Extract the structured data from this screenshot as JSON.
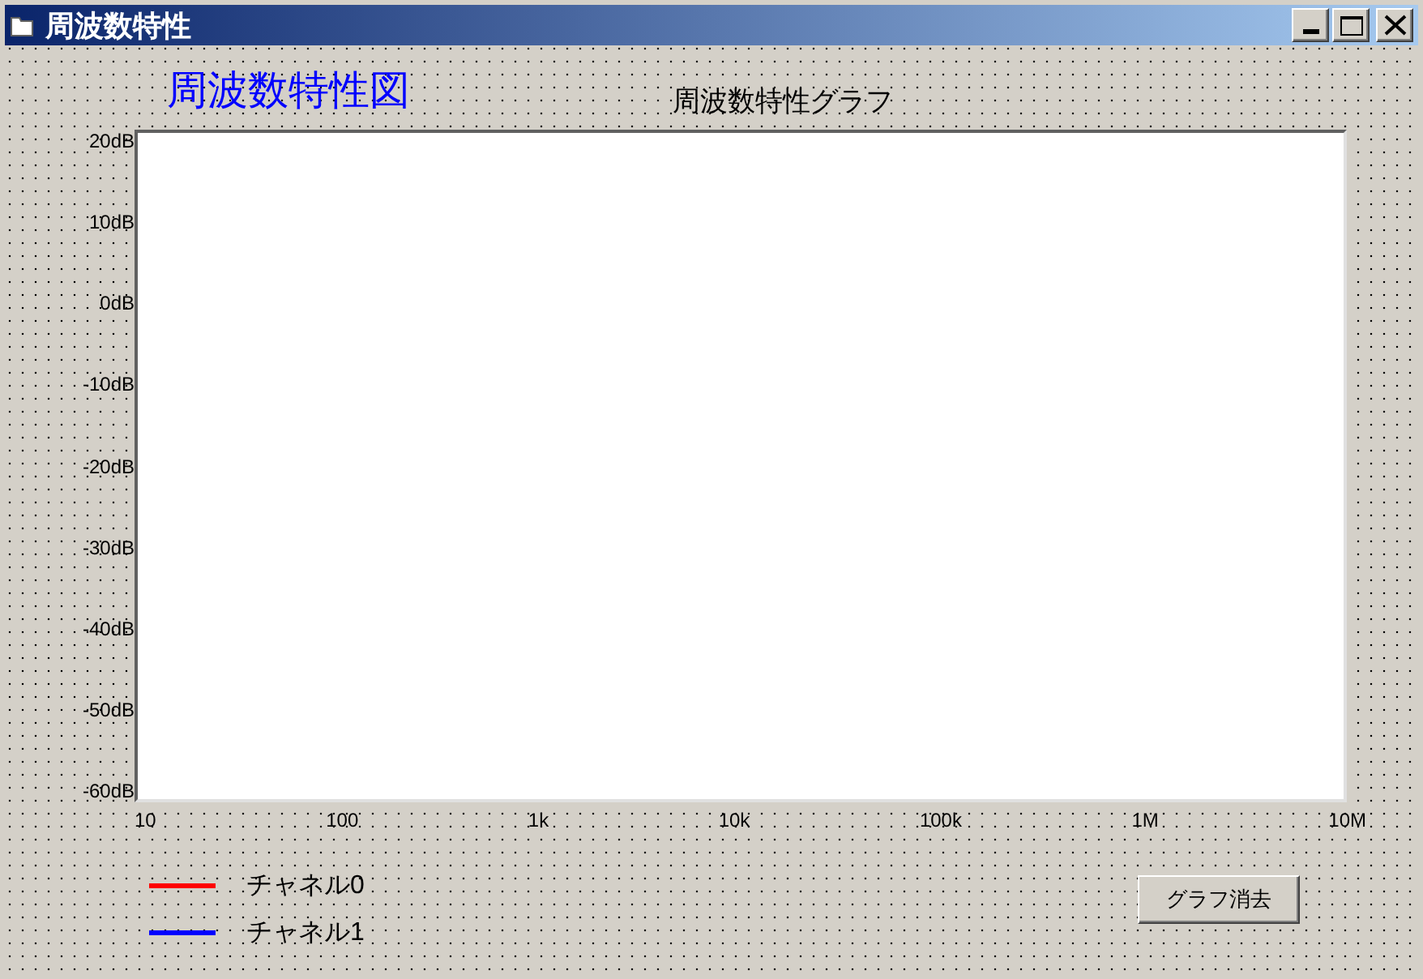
{
  "window": {
    "title": "周波数特性"
  },
  "heading": "周波数特性図",
  "graph": {
    "title": "周波数特性グラフ",
    "y_labels": [
      "20dB",
      "10dB",
      "0dB",
      "-10dB",
      "-20dB",
      "-30dB",
      "-40dB",
      "-50dB",
      "-60dB"
    ],
    "x_labels": [
      "10",
      "100",
      "1k",
      "10k",
      "100k",
      "1M",
      "10M"
    ]
  },
  "legend": [
    {
      "label": "チャネル0",
      "color": "#ff0000"
    },
    {
      "label": "チャネル1",
      "color": "#0000ff"
    }
  ],
  "buttons": [
    "グラフ消去"
  ]
}
